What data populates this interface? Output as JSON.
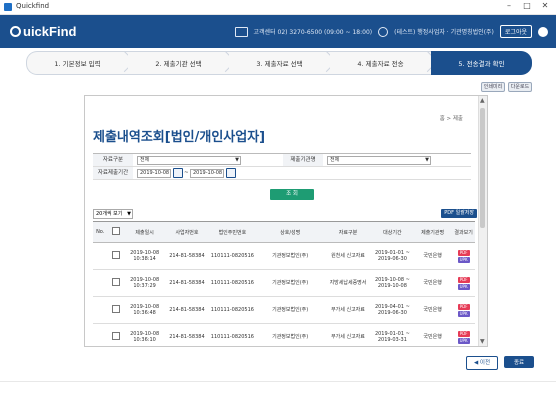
{
  "window": {
    "title": "Quickfind",
    "minimize": "–",
    "maximize": "□",
    "close": "✕"
  },
  "header": {
    "logo": "uickFind",
    "phone": "고객센터 02) 3270-6500 (09:00 ~ 18:00)",
    "user": "(테스트) 행정사업자 · 기관명칭법인(주)",
    "pill_label": "로그아웃",
    "brand_color": "#1b4f8d"
  },
  "steps": [
    {
      "label": "1. 기본정보 입력"
    },
    {
      "label": "2. 제출기관 선택"
    },
    {
      "label": "3. 제출자료 선택"
    },
    {
      "label": "4. 제출자료 전송"
    },
    {
      "label": "5. 전송결과 확인"
    }
  ],
  "top_buttons": [
    "인쇄미리",
    "다운로드"
  ],
  "main": {
    "breadcrumb": "홈 > 제출",
    "title": "제출내역조회[법인/개인사업자]",
    "form": {
      "doc_type_label": "자료구분",
      "doc_type_value": "전체",
      "org_label": "제출기관명",
      "org_value": "전체",
      "period_label": "자료제출기간",
      "date_from": "2019-10-08",
      "date_to": "2019-10-08",
      "separator": "~"
    },
    "search_label": "조 회",
    "page_size": "20개씩 보기",
    "pdf_all": "PDF 일괄저장"
  },
  "table": {
    "headers": [
      "No.",
      "",
      "제출일시",
      "사업자번호",
      "법인주민번호",
      "상호/성명",
      "자료구분",
      "대상기간",
      "제출기관명",
      "결과보기"
    ],
    "rows": [
      {
        "date": "2019-10-08 10:38:14",
        "biz": "214-81-58384",
        "corp": "110111-0820516",
        "name": "기관정보법인(주)",
        "type": "원천세 신고자료",
        "period": "2019-01-01 ~ 2019-06-30",
        "org": "국민은행"
      },
      {
        "date": "2019-10-08 10:37:29",
        "biz": "214-81-58384",
        "corp": "110111-0820516",
        "name": "기관정보법인(주)",
        "type": "지방세납세증명서",
        "period": "2019-10-08 ~ 2019-10-08",
        "org": "국민은행"
      },
      {
        "date": "2019-10-08 10:36:48",
        "biz": "214-81-58384",
        "corp": "110111-0820516",
        "name": "기관정보법인(주)",
        "type": "부가세 신고자료",
        "period": "2019-04-01 ~ 2019-06-30",
        "org": "국민은행"
      },
      {
        "date": "2019-10-08 10:36:10",
        "biz": "214-81-58384",
        "corp": "110111-0820516",
        "name": "기관정보법인(주)",
        "type": "부가세 신고자료",
        "period": "2019-01-01 ~ 2019-03-31",
        "org": "국민은행"
      }
    ],
    "pdf_label": "PDF",
    "upk_label": "UPK"
  },
  "footer": {
    "prev_label": "이전",
    "end_label": "종료"
  }
}
